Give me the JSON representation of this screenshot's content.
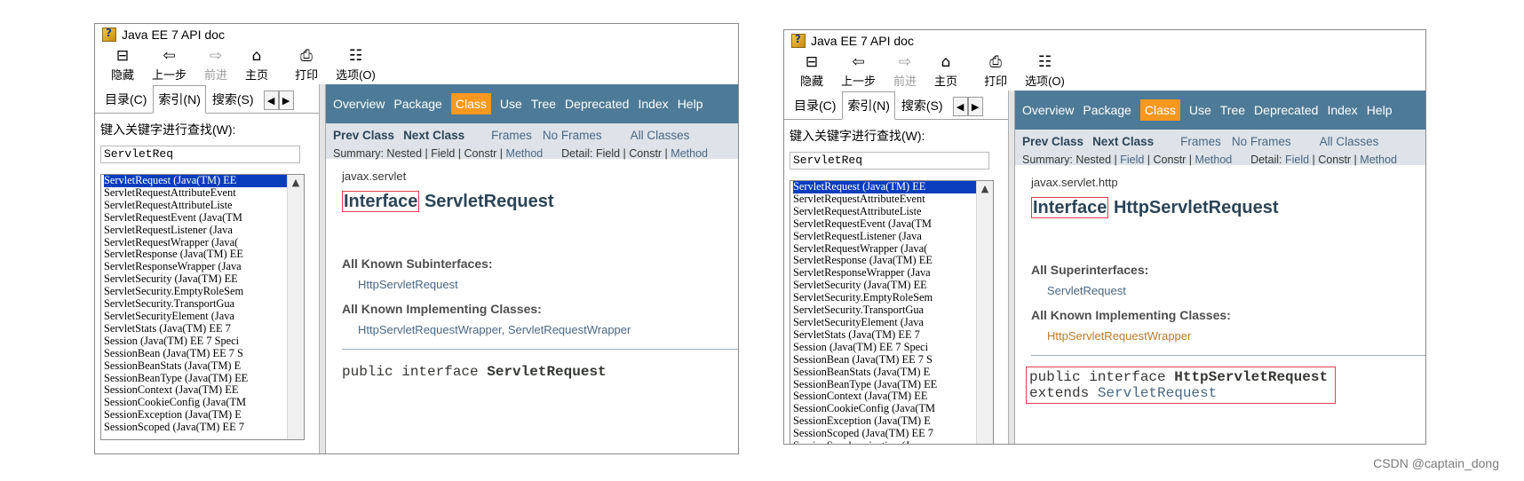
{
  "watermark": "CSDN @captain_dong",
  "windows": [
    {
      "title": "Java EE 7 API doc",
      "toolbar": [
        {
          "icon": "hide-icon",
          "glyph": "⊟",
          "label": "隐藏",
          "enabled": true
        },
        {
          "icon": "back-icon",
          "glyph": "⇦",
          "label": "上一步",
          "enabled": true
        },
        {
          "icon": "forward-icon",
          "glyph": "⇨",
          "label": "前进",
          "enabled": false
        },
        {
          "icon": "home-icon",
          "glyph": "⌂",
          "label": "主页",
          "enabled": true
        },
        {
          "icon": "print-icon",
          "glyph": "⎙",
          "label": "打印",
          "enabled": true
        },
        {
          "icon": "options-icon",
          "glyph": "☷",
          "label": "选项(O)",
          "enabled": true
        }
      ],
      "tabs": {
        "contents": "目录(C)",
        "index": "索引(N)",
        "search": "搜索(S)"
      },
      "keyword_label": "键入关键字进行查找(W):",
      "search_value": "ServletReq",
      "index_items": [
        "ServletRequest (Java(TM) EE",
        "ServletRequestAttributeEvent",
        "ServletRequestAttributeListe",
        "ServletRequestEvent (Java(TM",
        "ServletRequestListener (Java",
        "ServletRequestWrapper (Java(",
        "ServletResponse (Java(TM) EE",
        "ServletResponseWrapper (Java",
        "ServletSecurity (Java(TM) EE",
        "ServletSecurity.EmptyRoleSem",
        "ServletSecurity.TransportGua",
        "ServletSecurityElement (Java",
        "ServletStats (Java(TM) EE 7",
        "Session (Java(TM) EE 7 Speci",
        "SessionBean (Java(TM) EE 7 S",
        "SessionBeanStats (Java(TM) E",
        "SessionBeanType (Java(TM) EE",
        "SessionContext (Java(TM) EE",
        "SessionCookieConfig (Java(TM",
        "SessionException (Java(TM) E",
        "SessionScoped (Java(TM) EE 7"
      ],
      "nav": [
        "Overview",
        "Package",
        "Class",
        "Use",
        "Tree",
        "Deprecated",
        "Index",
        "Help"
      ],
      "nav_active": "Class",
      "subnav": {
        "prev": "Prev Class",
        "next": "Next Class",
        "frames": "Frames",
        "noframes": "No Frames",
        "all": "All Classes",
        "summary_prefix": "Summary: Nested | Field | Constr | ",
        "summary_method": "Method",
        "detail_prefix": "Detail: Field | Constr | ",
        "detail_field": "",
        "detail_method": "Method"
      },
      "package": "javax.servlet",
      "kind": "Interface",
      "name": "ServletRequest",
      "sections": [
        {
          "heading": "All Known Subinterfaces:",
          "items": "HttpServletRequest"
        },
        {
          "heading": "All Known Implementing Classes:",
          "items": "HttpServletRequestWrapper, ServletRequestWrapper"
        }
      ],
      "decl_prefix": "public interface ",
      "decl_name": "ServletRequest"
    },
    {
      "title": "Java EE 7 API doc",
      "toolbar": [
        {
          "icon": "hide-icon",
          "glyph": "⊟",
          "label": "隐藏",
          "enabled": true
        },
        {
          "icon": "back-icon",
          "glyph": "⇦",
          "label": "上一步",
          "enabled": true
        },
        {
          "icon": "forward-icon",
          "glyph": "⇨",
          "label": "前进",
          "enabled": false
        },
        {
          "icon": "home-icon",
          "glyph": "⌂",
          "label": "主页",
          "enabled": true
        },
        {
          "icon": "print-icon",
          "glyph": "⎙",
          "label": "打印",
          "enabled": true
        },
        {
          "icon": "options-icon",
          "glyph": "☷",
          "label": "选项(O)",
          "enabled": true
        }
      ],
      "tabs": {
        "contents": "目录(C)",
        "index": "索引(N)",
        "search": "搜索(S)"
      },
      "keyword_label": "键入关键字进行查找(W):",
      "search_value": "ServletReq",
      "index_items": [
        "ServletRequest (Java(TM) EE",
        "ServletRequestAttributeEvent",
        "ServletRequestAttributeListe",
        "ServletRequestEvent (Java(TM",
        "ServletRequestListener (Java",
        "ServletRequestWrapper (Java(",
        "ServletResponse (Java(TM) EE",
        "ServletResponseWrapper (Java",
        "ServletSecurity (Java(TM) EE",
        "ServletSecurity.EmptyRoleSem",
        "ServletSecurity.TransportGua",
        "ServletSecurityElement (Java",
        "ServletStats (Java(TM) EE 7",
        "Session (Java(TM) EE 7 Speci",
        "SessionBean (Java(TM) EE 7 S",
        "SessionBeanStats (Java(TM) E",
        "SessionBeanType (Java(TM) EE",
        "SessionContext (Java(TM) EE",
        "SessionCookieConfig (Java(TM",
        "SessionException (Java(TM) E",
        "SessionScoped (Java(TM) EE 7",
        "SessionSynchronization (Java"
      ],
      "nav": [
        "Overview",
        "Package",
        "Class",
        "Use",
        "Tree",
        "Deprecated",
        "Index",
        "Help"
      ],
      "nav_active": "Class",
      "subnav": {
        "prev": "Prev Class",
        "next": "Next Class",
        "frames": "Frames",
        "noframes": "No Frames",
        "all": "All Classes",
        "summary_prefix": "Summary: Nested | ",
        "summary_mid": "Field",
        "summary_rest": " | Constr | ",
        "summary_method": "Method",
        "detail_prefix": "Detail: ",
        "detail_field": "Field",
        "detail_rest": " | Constr | ",
        "detail_method": "Method"
      },
      "package": "javax.servlet.http",
      "kind": "Interface",
      "name": "HttpServletRequest",
      "sections": [
        {
          "heading": "All Superinterfaces:",
          "items": "ServletRequest"
        },
        {
          "heading": "All Known Implementing Classes:",
          "items": "HttpServletRequestWrapper"
        }
      ],
      "decl_prefix": "public interface ",
      "decl_name": "HttpServletRequest",
      "decl_extends": "extends ",
      "decl_super": "ServletRequest"
    }
  ]
}
